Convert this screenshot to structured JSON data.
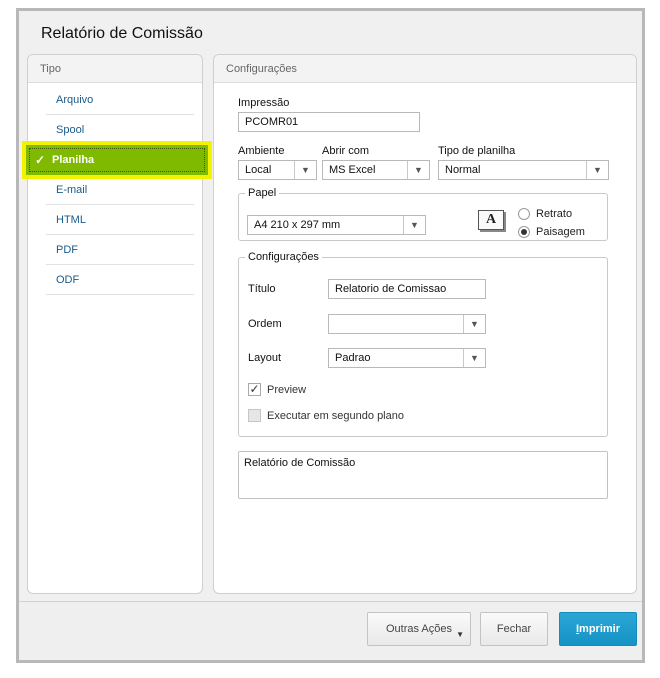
{
  "dialog": {
    "title": "Relatório de Comissão"
  },
  "left_panel": {
    "header": "Tipo",
    "items": [
      {
        "label": "Arquivo",
        "selected": false
      },
      {
        "label": "Spool",
        "selected": false
      },
      {
        "label": "Planilha",
        "selected": true
      },
      {
        "label": "E-mail",
        "selected": false
      },
      {
        "label": "HTML",
        "selected": false
      },
      {
        "label": "PDF",
        "selected": false
      },
      {
        "label": "ODF",
        "selected": false
      }
    ],
    "selected_check": "✓",
    "highlight_color": "#f2f200",
    "selected_color": "#7fba00"
  },
  "right_panel": {
    "header": "Configurações",
    "impressao": {
      "label": "Impressão",
      "value": "PCOMR01"
    },
    "ambiente": {
      "label": "Ambiente",
      "value": "Local"
    },
    "abrir_com": {
      "label": "Abrir com",
      "value": "MS Excel"
    },
    "tipo_planilha": {
      "label": "Tipo de planilha",
      "value": "Normal"
    },
    "papel": {
      "legend": "Papel",
      "size": "A4 210 x 297 mm",
      "icon": "paper-orientation-icon",
      "icon_glyph": "A",
      "orientation_options": [
        {
          "label": "Retrato",
          "selected": false
        },
        {
          "label": "Paisagem",
          "selected": true
        }
      ]
    },
    "config_group": {
      "legend": "Configurações",
      "titulo": {
        "label": "Título",
        "value": "Relatorio de Comissao"
      },
      "ordem": {
        "label": "Ordem",
        "value": ""
      },
      "layout": {
        "label": "Layout",
        "value": "Padrao"
      },
      "preview": {
        "label": "Preview",
        "checked": true
      },
      "segundo_plano": {
        "label": "Executar em segundo plano",
        "checked": false
      }
    },
    "description": "Relatório de Comissão"
  },
  "footer": {
    "outras_acoes": "Outras Ações",
    "fechar": "Fechar",
    "imprimir_underlined": "I",
    "imprimir_rest": "mprimir",
    "accent": "#1a9bcc"
  },
  "glyphs": {
    "dropdown_arrow": "▼",
    "checkmark": "✓"
  }
}
